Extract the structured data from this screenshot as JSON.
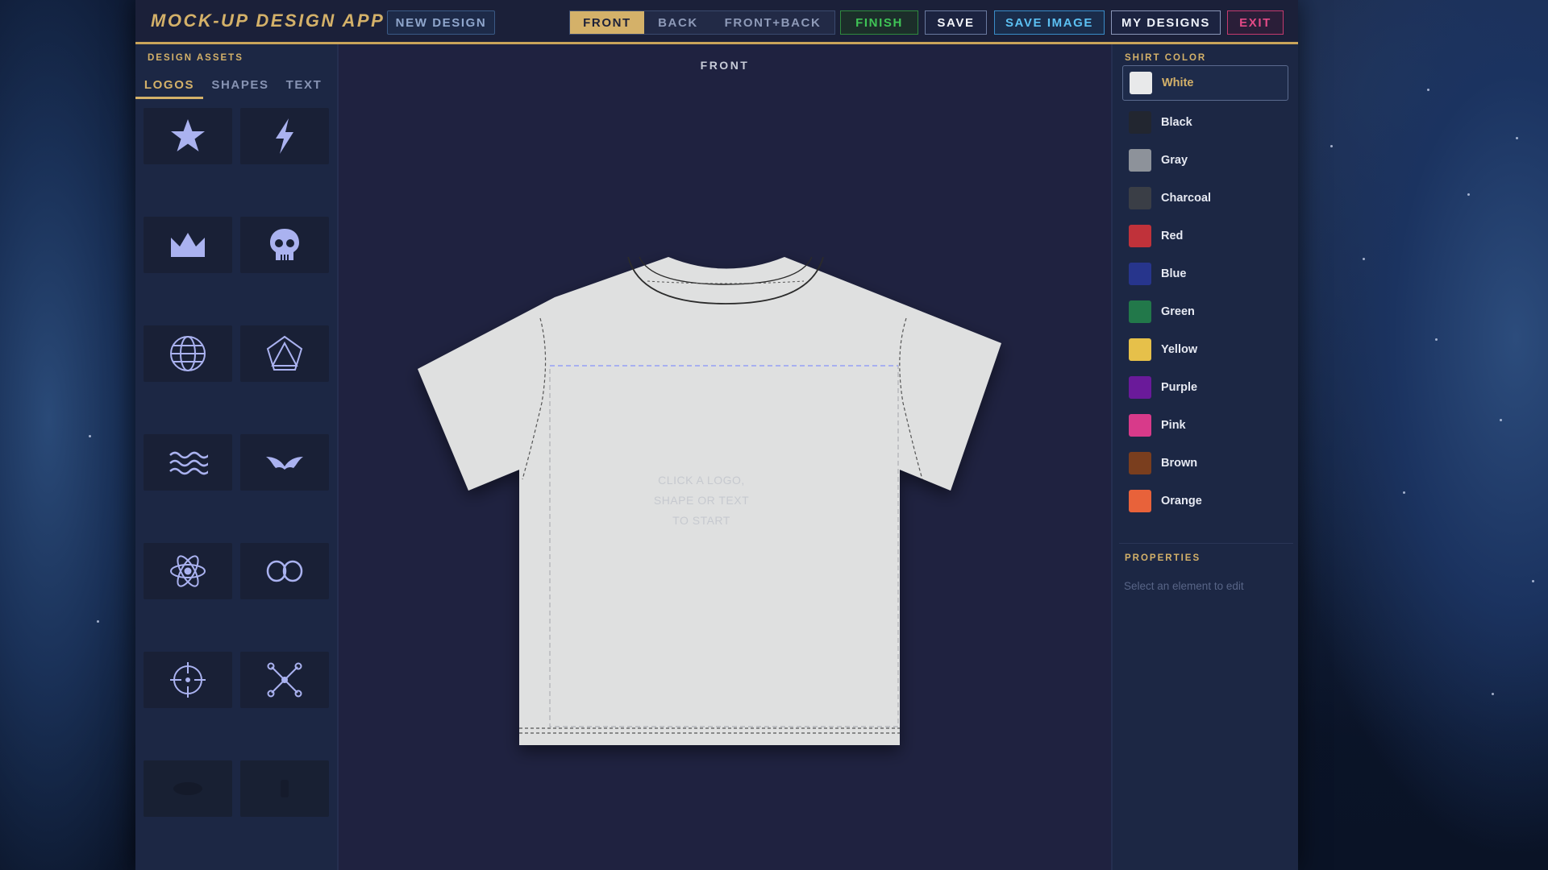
{
  "header": {
    "title": "MOCK-UP DESIGN APP",
    "new_design": "NEW DESIGN",
    "views": [
      {
        "label": "FRONT",
        "active": true
      },
      {
        "label": "BACK",
        "active": false
      },
      {
        "label": "FRONT+BACK",
        "active": false
      }
    ],
    "finish": "FINISH",
    "save": "SAVE",
    "save_image": "SAVE IMAGE",
    "my_designs": "MY DESIGNS",
    "exit": "EXIT"
  },
  "assets": {
    "label": "DESIGN ASSETS",
    "tabs": [
      {
        "label": "LOGOS",
        "active": true
      },
      {
        "label": "SHAPES",
        "active": false
      },
      {
        "label": "TEXT",
        "active": false
      }
    ],
    "logos": [
      "star-icon",
      "lightning-icon",
      "crown-icon",
      "skull-icon",
      "globe-icon",
      "pentagon-icon",
      "waves-icon",
      "wings-icon",
      "atom-icon",
      "infinity-icon",
      "crosshair-icon",
      "crossbones-icon",
      "dim-logo-icon",
      "dim-figure-icon"
    ],
    "icon_color": "#aab2f0"
  },
  "canvas": {
    "side_label": "FRONT",
    "hint_lines": [
      "CLICK A LOGO,",
      "SHAPE OR TEXT",
      "TO START"
    ],
    "shirt_color": "#dfe0e0"
  },
  "shirt_colors": {
    "label": "SHIRT COLOR",
    "items": [
      {
        "name": "White",
        "hex": "#e8e9ea",
        "selected": true
      },
      {
        "name": "Black",
        "hex": "#222630",
        "selected": false
      },
      {
        "name": "Gray",
        "hex": "#8d929a",
        "selected": false
      },
      {
        "name": "Charcoal",
        "hex": "#3a3e46",
        "selected": false
      },
      {
        "name": "Red",
        "hex": "#c0323a",
        "selected": false
      },
      {
        "name": "Blue",
        "hex": "#27358c",
        "selected": false
      },
      {
        "name": "Green",
        "hex": "#22784a",
        "selected": false
      },
      {
        "name": "Yellow",
        "hex": "#e6c04a",
        "selected": false
      },
      {
        "name": "Purple",
        "hex": "#6a1a9a",
        "selected": false
      },
      {
        "name": "Pink",
        "hex": "#d83a8a",
        "selected": false
      },
      {
        "name": "Brown",
        "hex": "#7a3e1e",
        "selected": false
      },
      {
        "name": "Orange",
        "hex": "#e8623a",
        "selected": false
      }
    ]
  },
  "properties": {
    "label": "PROPERTIES",
    "hint": "Select an element to edit"
  }
}
